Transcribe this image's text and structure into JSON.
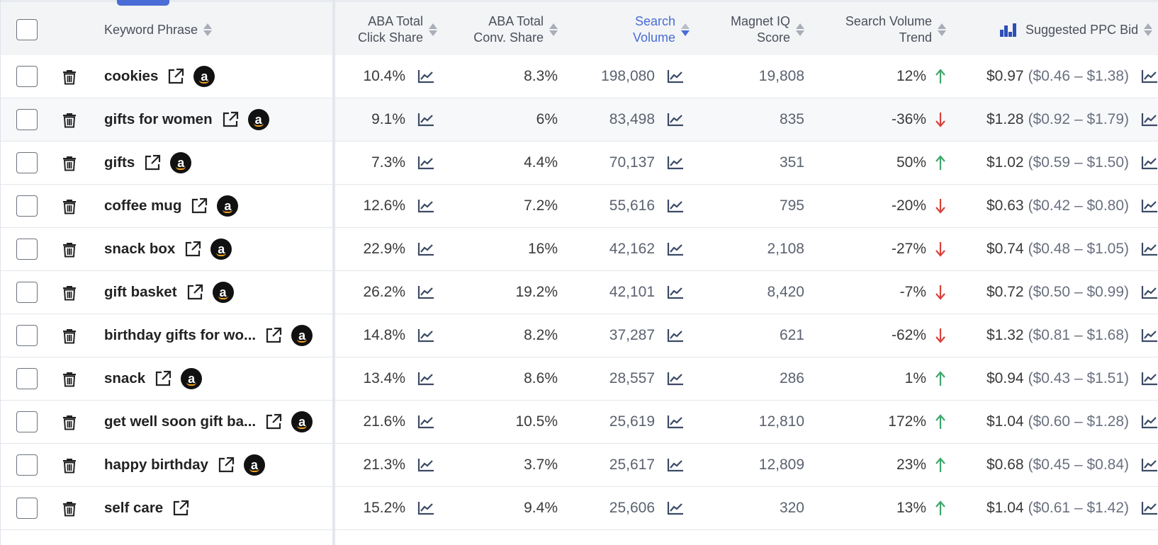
{
  "colors": {
    "accent": "#4a6cd6",
    "up": "#3ea76a",
    "down": "#d9413a",
    "icon": "#3c4a66"
  },
  "header": {
    "keyword_phrase": "Keyword Phrase",
    "aba_click_1": "ABA Total",
    "aba_click_2": "Click Share",
    "aba_conv_1": "ABA Total",
    "aba_conv_2": "Conv. Share",
    "search_volume_1": "Search",
    "search_volume_2": "Volume",
    "magnet_iq_1": "Magnet IQ",
    "magnet_iq_2": "Score",
    "sv_trend_1": "Search Volume",
    "sv_trend_2": "Trend",
    "ppc_bid": "Suggested PPC Bid"
  },
  "amazon_badge": "a",
  "rows": [
    {
      "keyword": "cookies",
      "click_share": "10.4%",
      "conv_share": "8.3%",
      "search_volume": "198,080",
      "iq_score": "19,808",
      "trend": "12%",
      "trend_dir": "up",
      "ppc": "$0.97",
      "ppc_range": "($0.46 – $1.38)",
      "amazon": true,
      "highlight": false
    },
    {
      "keyword": "gifts for women",
      "click_share": "9.1%",
      "conv_share": "6%",
      "search_volume": "83,498",
      "iq_score": "835",
      "trend": "-36%",
      "trend_dir": "down",
      "ppc": "$1.28",
      "ppc_range": "($0.92 – $1.79)",
      "amazon": true,
      "highlight": true
    },
    {
      "keyword": "gifts",
      "click_share": "7.3%",
      "conv_share": "4.4%",
      "search_volume": "70,137",
      "iq_score": "351",
      "trend": "50%",
      "trend_dir": "up",
      "ppc": "$1.02",
      "ppc_range": "($0.59 – $1.50)",
      "amazon": true,
      "highlight": false
    },
    {
      "keyword": "coffee mug",
      "click_share": "12.6%",
      "conv_share": "7.2%",
      "search_volume": "55,616",
      "iq_score": "795",
      "trend": "-20%",
      "trend_dir": "down",
      "ppc": "$0.63",
      "ppc_range": "($0.42 – $0.80)",
      "amazon": true,
      "highlight": false
    },
    {
      "keyword": "snack box",
      "click_share": "22.9%",
      "conv_share": "16%",
      "search_volume": "42,162",
      "iq_score": "2,108",
      "trend": "-27%",
      "trend_dir": "down",
      "ppc": "$0.74",
      "ppc_range": "($0.48 – $1.05)",
      "amazon": true,
      "highlight": false
    },
    {
      "keyword": "gift basket",
      "click_share": "26.2%",
      "conv_share": "19.2%",
      "search_volume": "42,101",
      "iq_score": "8,420",
      "trend": "-7%",
      "trend_dir": "down",
      "ppc": "$0.72",
      "ppc_range": "($0.50 – $0.99)",
      "amazon": true,
      "highlight": false
    },
    {
      "keyword": "birthday gifts for wo...",
      "click_share": "14.8%",
      "conv_share": "8.2%",
      "search_volume": "37,287",
      "iq_score": "621",
      "trend": "-62%",
      "trend_dir": "down",
      "ppc": "$1.32",
      "ppc_range": "($0.81 – $1.68)",
      "amazon": true,
      "highlight": false
    },
    {
      "keyword": "snack",
      "click_share": "13.4%",
      "conv_share": "8.6%",
      "search_volume": "28,557",
      "iq_score": "286",
      "trend": "1%",
      "trend_dir": "up",
      "ppc": "$0.94",
      "ppc_range": "($0.43 – $1.51)",
      "amazon": true,
      "highlight": false
    },
    {
      "keyword": "get well soon gift ba...",
      "click_share": "21.6%",
      "conv_share": "10.5%",
      "search_volume": "25,619",
      "iq_score": "12,810",
      "trend": "172%",
      "trend_dir": "up",
      "ppc": "$1.04",
      "ppc_range": "($0.60 – $1.28)",
      "amazon": true,
      "highlight": false
    },
    {
      "keyword": "happy birthday",
      "click_share": "21.3%",
      "conv_share": "3.7%",
      "search_volume": "25,617",
      "iq_score": "12,809",
      "trend": "23%",
      "trend_dir": "up",
      "ppc": "$0.68",
      "ppc_range": "($0.45 – $0.84)",
      "amazon": true,
      "highlight": false
    },
    {
      "keyword": "self care",
      "click_share": "15.2%",
      "conv_share": "9.4%",
      "search_volume": "25,606",
      "iq_score": "320",
      "trend": "13%",
      "trend_dir": "up",
      "ppc": "$1.04",
      "ppc_range": "($0.61 – $1.42)",
      "amazon": false,
      "highlight": false
    }
  ]
}
